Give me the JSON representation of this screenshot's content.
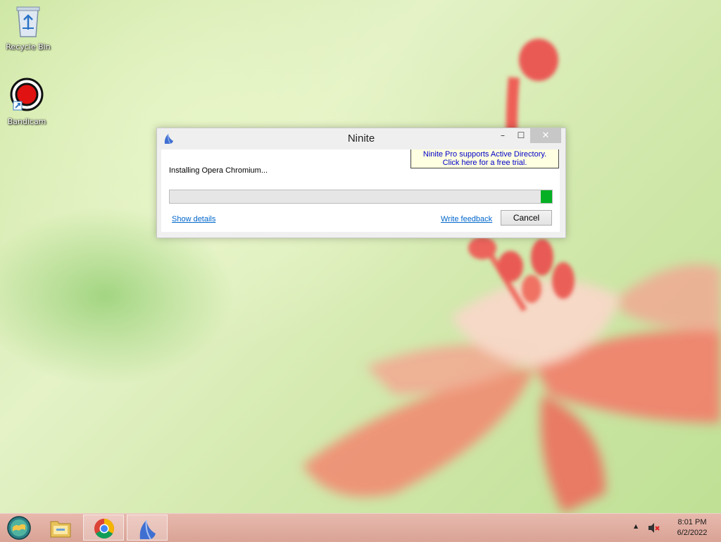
{
  "desktop": {
    "icons": [
      {
        "label": "Recycle Bin",
        "icon": "recycle-bin-icon"
      },
      {
        "label": "Bandicam",
        "icon": "bandicam-icon"
      }
    ]
  },
  "window": {
    "title": "Ninite",
    "controls": {
      "minimize": "–",
      "maximize": "☐",
      "close": "✕"
    },
    "promo_line1": "Ninite Pro supports Active Directory.",
    "promo_line2": "Click here for a free trial.",
    "status": "Installing Opera Chromium...",
    "progress_percent": 97,
    "progress_color": "#06b025",
    "show_details": "Show details",
    "write_feedback": "Write feedback",
    "cancel": "Cancel"
  },
  "taskbar": {
    "items": [
      {
        "name": "start-button",
        "icon": "windows-orb-icon"
      },
      {
        "name": "file-explorer",
        "icon": "folder-icon"
      },
      {
        "name": "chrome",
        "icon": "chrome-icon"
      },
      {
        "name": "ninite",
        "icon": "ninite-icon",
        "active": true
      }
    ],
    "tray": {
      "show_hidden": "▲",
      "volume": "volume-muted-icon"
    },
    "clock_time": "8:01 PM",
    "clock_date": "6/2/2022",
    "accent": "#dfab9f"
  }
}
